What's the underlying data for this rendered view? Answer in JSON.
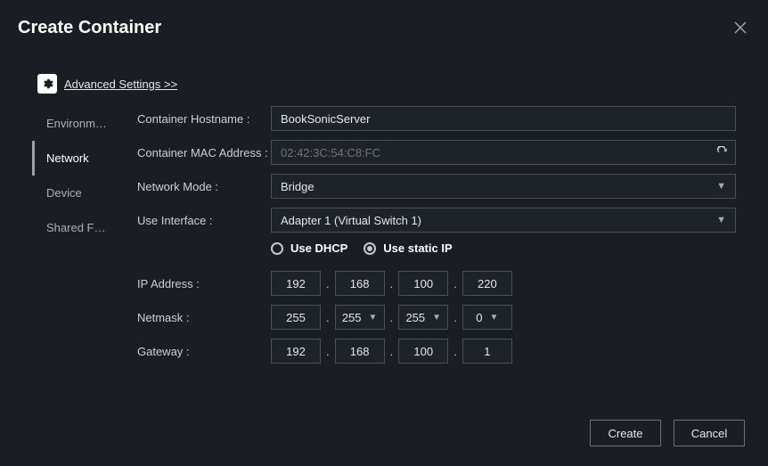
{
  "header": {
    "title": "Create Container"
  },
  "advanced": {
    "label": "Advanced Settings >>"
  },
  "sidebar": {
    "items": [
      {
        "label": "Environm…"
      },
      {
        "label": "Network"
      },
      {
        "label": "Device"
      },
      {
        "label": "Shared F…"
      }
    ]
  },
  "form": {
    "hostname_label": "Container Hostname :",
    "hostname_value": "BookSonicServer",
    "mac_label": "Container MAC Address :",
    "mac_placeholder": "02:42:3C:54:C8:FC",
    "mode_label": "Network Mode :",
    "mode_value": "Bridge",
    "iface_label": "Use Interface :",
    "iface_value": "Adapter 1 (Virtual Switch 1)",
    "radio": {
      "dhcp": "Use DHCP",
      "static": "Use static IP"
    },
    "ip_label": "IP Address :",
    "ip": {
      "a": "192",
      "b": "168",
      "c": "100",
      "d": "220"
    },
    "netmask_label": "Netmask :",
    "netmask": {
      "a": "255",
      "b": "255",
      "c": "255",
      "d": "0"
    },
    "gateway_label": "Gateway :",
    "gateway": {
      "a": "192",
      "b": "168",
      "c": "100",
      "d": "1"
    }
  },
  "footer": {
    "create": "Create",
    "cancel": "Cancel"
  }
}
